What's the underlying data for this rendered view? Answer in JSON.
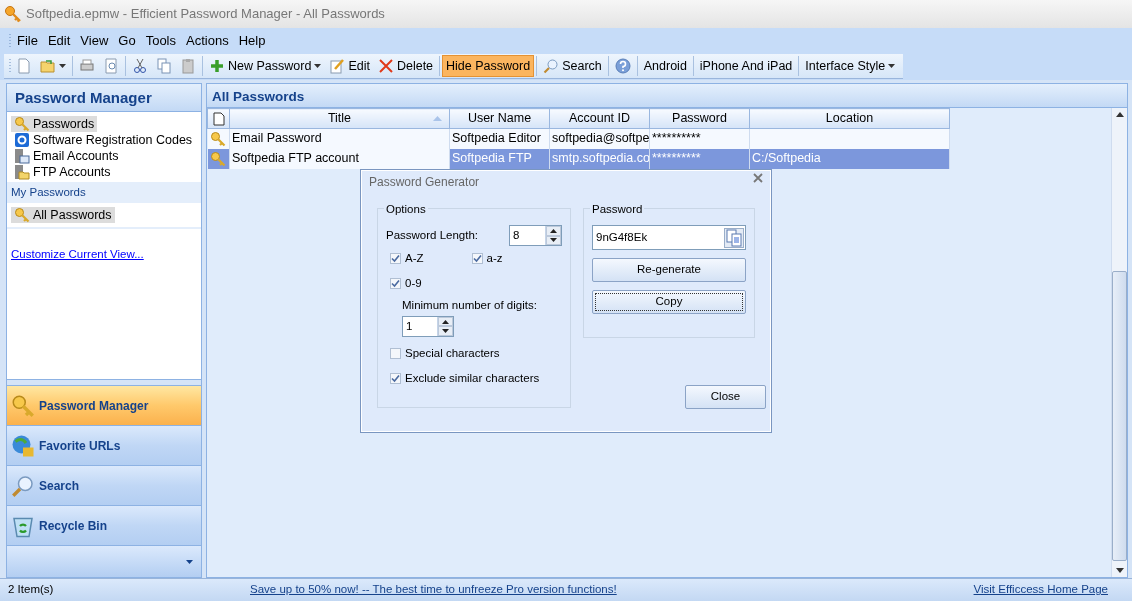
{
  "window": {
    "title": "Softpedia.epmw - Efficient Password Manager - All Passwords"
  },
  "menu": [
    "File",
    "Edit",
    "View",
    "Go",
    "Tools",
    "Actions",
    "Help"
  ],
  "toolbar": [
    {
      "label": "New Password",
      "dropdown": true,
      "on": false
    },
    {
      "label": "Edit",
      "dropdown": false,
      "on": false
    },
    {
      "label": "Delete",
      "dropdown": false,
      "on": false
    },
    {
      "label": "Hide Password",
      "dropdown": false,
      "on": true
    },
    {
      "label": "Search",
      "dropdown": false,
      "on": false
    },
    {
      "label": "Android",
      "dropdown": false,
      "on": false
    },
    {
      "label": "iPhone And iPad",
      "dropdown": false,
      "on": false
    },
    {
      "label": "Interface Style",
      "dropdown": true,
      "on": false
    }
  ],
  "sidebar": {
    "title": "Password Manager",
    "items": [
      {
        "label": "Passwords",
        "selected": true
      },
      {
        "label": "Software Registration Codes",
        "selected": false
      },
      {
        "label": "Email Accounts",
        "selected": false
      },
      {
        "label": "FTP Accounts",
        "selected": false
      }
    ],
    "group_label": "My Passwords",
    "group_items": [
      {
        "label": "All Passwords",
        "selected": true
      }
    ],
    "link": "Customize Current View...",
    "nav_buttons": [
      {
        "label": "Password Manager",
        "selected": true
      },
      {
        "label": "Favorite URLs",
        "selected": false
      },
      {
        "label": "Search",
        "selected": false
      },
      {
        "label": "Recycle Bin",
        "selected": false
      }
    ]
  },
  "table": {
    "title": "All Passwords",
    "columns": [
      {
        "label": "Title",
        "sorted": true
      },
      {
        "label": "User Name",
        "sorted": false
      },
      {
        "label": "Account ID",
        "sorted": false
      },
      {
        "label": "Password",
        "sorted": false
      },
      {
        "label": "Location",
        "sorted": false
      }
    ],
    "rows": [
      {
        "cells": [
          "Email Password",
          "Softpedia Editor",
          "softpedia@softpe",
          "**********",
          ""
        ],
        "selected": false
      },
      {
        "cells": [
          "Softpedia FTP account",
          "Softpedia FTP",
          "smtp.softpedia.co",
          "**********",
          "C:/Softpedia"
        ],
        "selected": true
      }
    ]
  },
  "dialog": {
    "title": "Password Generator",
    "options_label": "Options",
    "length_label": "Password Length:",
    "length_value": "8",
    "checkboxes": [
      {
        "label": "A-Z",
        "checked": true
      },
      {
        "label": "a-z",
        "checked": true
      },
      {
        "label": "0-9",
        "checked": true
      },
      {
        "label": "Special characters",
        "checked": false
      },
      {
        "label": "Exclude similar characters",
        "checked": true
      }
    ],
    "min_digits_label": "Minimum number of digits:",
    "min_digits_value": "1",
    "password_label": "Password",
    "password_value": "9nG4f8Ek",
    "regenerate": "Re-generate",
    "copy": "Copy",
    "close": "Close"
  },
  "status_bar": {
    "count": "2 Item(s)",
    "promo": "Save up to 50% now! -- The best time to unfreeze Pro version functions!",
    "home_link": "Visit Efficcess Home Page"
  }
}
